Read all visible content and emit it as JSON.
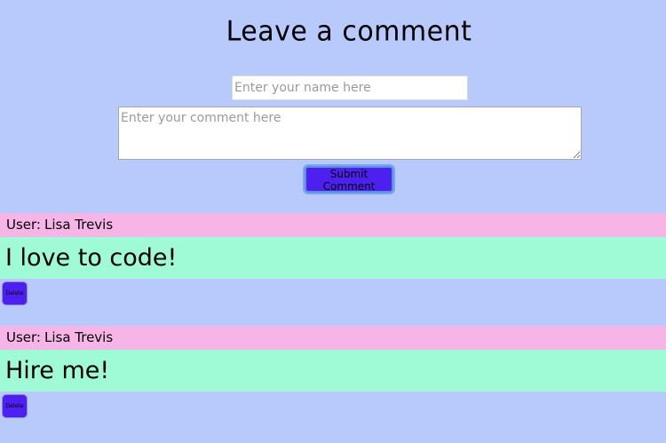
{
  "form": {
    "title": "Leave a comment",
    "name_placeholder": "Enter your name here",
    "comment_placeholder": "Enter your comment here",
    "submit_label": "Submit Comment"
  },
  "comments": [
    {
      "user_prefix": "User:",
      "user": "Lisa Trevis",
      "text": "I love to code!",
      "delete_label": "Delete"
    },
    {
      "user_prefix": "User:",
      "user": "Lisa Trevis",
      "text": "Hire me!",
      "delete_label": "Delete"
    }
  ],
  "colors": {
    "background": "#b8cafc",
    "user_bar": "#f6b5e6",
    "comment_bar": "#9ffbd6",
    "button": "#4e20f0"
  }
}
